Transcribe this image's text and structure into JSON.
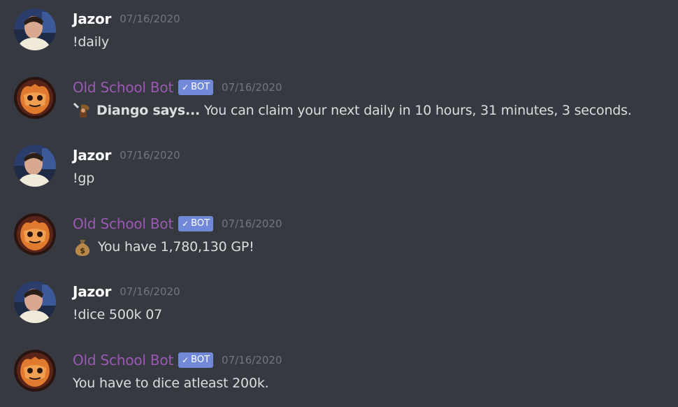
{
  "messages": [
    {
      "author": "Jazor",
      "timestamp": "07/16/2020",
      "text": "!daily",
      "is_bot": false
    },
    {
      "author": "Old School Bot",
      "timestamp": "07/16/2020",
      "bot_tag": "BOT",
      "bold_prefix": "Diango says...",
      "text": "You can claim your next daily in 10 hours, 31 minutes, 3 seconds.",
      "emoji": "diango-icon",
      "is_bot": true
    },
    {
      "author": "Jazor",
      "timestamp": "07/16/2020",
      "text": "!gp",
      "is_bot": false
    },
    {
      "author": "Old School Bot",
      "timestamp": "07/16/2020",
      "bot_tag": "BOT",
      "text": "You have 1,780,130 GP!",
      "emoji": "money-bag-icon",
      "is_bot": true
    },
    {
      "author": "Jazor",
      "timestamp": "07/16/2020",
      "text": "!dice 500k 07",
      "is_bot": false
    },
    {
      "author": "Old School Bot",
      "timestamp": "07/16/2020",
      "bot_tag": "BOT",
      "text": "You have to dice atleast 200k.",
      "is_bot": true
    }
  ],
  "colors": {
    "background": "#36393f",
    "username": "#ffffff",
    "bot_username": "#9b59b6",
    "bot_tag": "#7289da",
    "timestamp": "#72767d",
    "text": "#dcddde"
  }
}
